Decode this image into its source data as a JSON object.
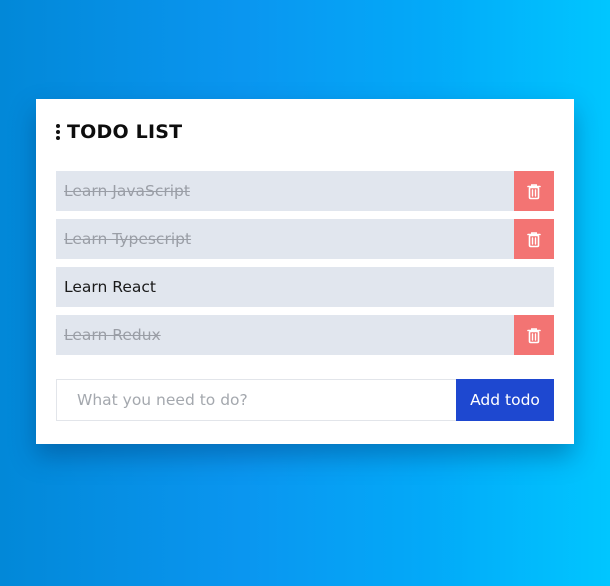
{
  "header": {
    "title": "TODO LIST",
    "menu_icon": "kebab-menu-icon"
  },
  "todos": [
    {
      "label": "Learn JavaScript",
      "completed": true,
      "delete_icon": "trash-icon"
    },
    {
      "label": "Learn Typescript",
      "completed": true,
      "delete_icon": "trash-icon"
    },
    {
      "label": "Learn React",
      "completed": false
    },
    {
      "label": "Learn Redux",
      "completed": true,
      "delete_icon": "trash-icon"
    }
  ],
  "add_todo": {
    "placeholder": "What you need to do?",
    "value": "",
    "button_label": "Add todo"
  },
  "colors": {
    "accent": "#1e48d0",
    "delete": "#f37473",
    "item_bg": "#e1e6ee"
  }
}
